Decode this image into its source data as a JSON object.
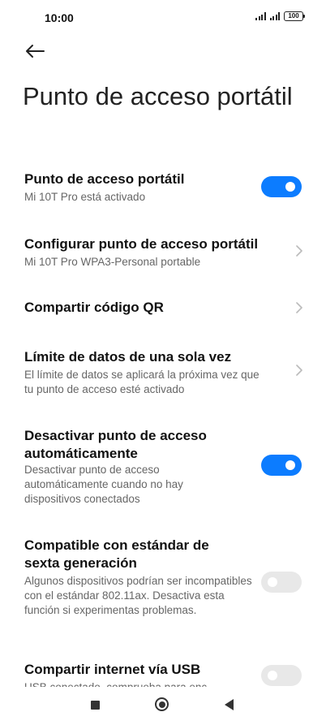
{
  "status_bar": {
    "time": "10:00",
    "battery": "100"
  },
  "header": {
    "title": "Punto de acceso portátil"
  },
  "settings": [
    {
      "title": "Punto de acceso portátil",
      "subtitle": "Mi 10T Pro está activado",
      "control": "toggle",
      "state": "on"
    },
    {
      "title": "Configurar punto de acceso portátil",
      "subtitle": "Mi 10T Pro WPA3-Personal portable",
      "control": "chevron"
    },
    {
      "title": "Compartir código QR",
      "control": "chevron"
    },
    {
      "title": "Límite de datos de una sola vez",
      "subtitle": "El límite de datos se aplicará la próxima vez que tu punto de acceso esté activado",
      "control": "chevron"
    },
    {
      "title": "Desactivar punto de acceso automáticamente",
      "subtitle": "Desactivar punto de acceso automáticamente cuando no hay dispositivos conectados",
      "control": "toggle",
      "state": "on"
    },
    {
      "title": "Compatible con estándar de sexta generación",
      "subtitle": "Algunos dispositivos podrían ser incompatibles con el estándar 802.11ax. Desactiva esta función si experimentas problemas.",
      "control": "toggle",
      "state": "off"
    },
    {
      "title": "Compartir internet vía USB",
      "subtitle": "USB conectado, comprueba para enc",
      "control": "toggle",
      "state": "off"
    }
  ],
  "colors": {
    "accent": "#0c7cff",
    "toggle_off": "#e8e8e8",
    "subtitle": "#666666"
  },
  "nav_bar": {
    "icons": [
      "recents-square-icon",
      "home-circle-icon",
      "back-triangle-icon"
    ]
  }
}
